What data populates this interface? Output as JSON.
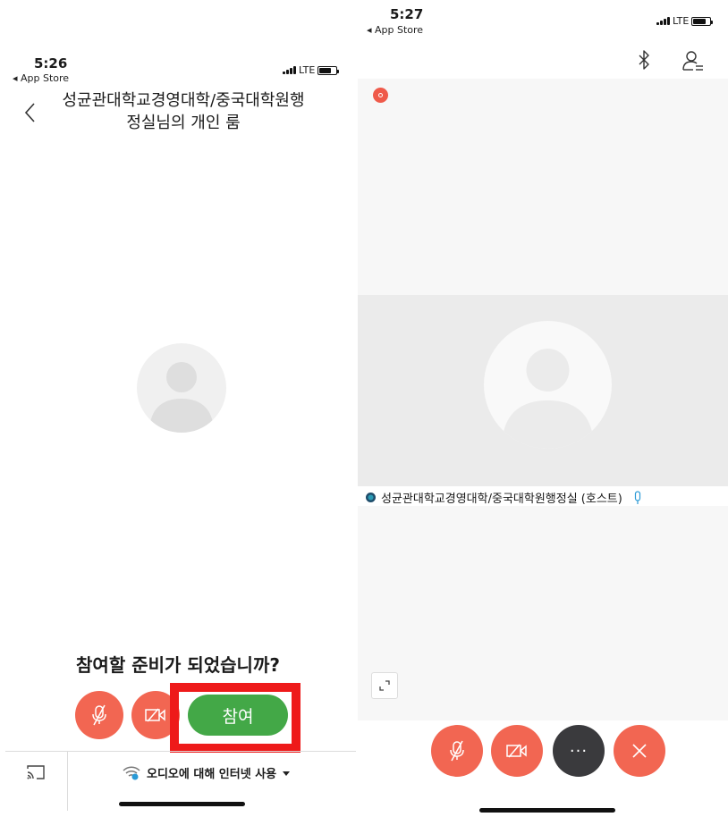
{
  "left": {
    "status": {
      "time": "5:26",
      "back_app": "◂ App Store",
      "network": "LTE"
    },
    "room_title_line1": "성균관대학교경영대학/중국대학원행",
    "room_title_line2": "정실님의 개인 룸",
    "prompt": "참여할 준비가 되었습니까?",
    "join_label": "참여",
    "audio_option_label": "오디오에 대해 인터넷 사용"
  },
  "right": {
    "status": {
      "time": "5:27",
      "back_app": "◂ App Store",
      "network": "LTE"
    },
    "host_label": "성균관대학교경영대학/중국대학원행정실 (호스트)",
    "more_label": "···"
  },
  "colors": {
    "accent_red": "#f26652",
    "join_green": "#43a847",
    "highlight_red": "#ee1a1a",
    "more_dark": "#3a3a3d",
    "host_status_teal": "#2a9bb5"
  },
  "icons": {
    "left_toolbar": [
      "back-chevron-icon"
    ],
    "left_controls": [
      "microphone-muted-icon",
      "video-off-icon",
      "cast-screen-icon",
      "wifi-icon",
      "chevron-down-icon"
    ],
    "right_toolbar": [
      "bluetooth-icon",
      "participants-icon"
    ],
    "right_controls": [
      "recording-icon",
      "microphone-muted-icon",
      "video-off-icon",
      "more-icon",
      "close-icon",
      "expand-icon",
      "microphone-icon"
    ]
  }
}
